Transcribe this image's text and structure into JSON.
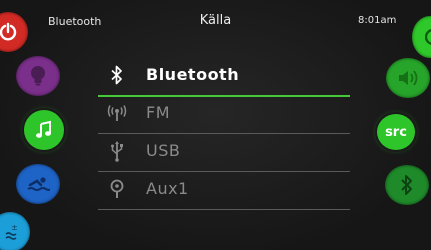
{
  "header": {
    "left_label": "Bluetooth",
    "title": "Källa",
    "time": "8:01am"
  },
  "left_buttons": [
    {
      "name": "power",
      "icon": "power-icon",
      "color": "#d22a25"
    },
    {
      "name": "light",
      "icon": "lightbulb-icon",
      "color": "#7a2f8a"
    },
    {
      "name": "audio",
      "icon": "music-note-icon",
      "color": "#2ec52a",
      "selected": true
    },
    {
      "name": "swim",
      "icon": "swimmer-icon",
      "color": "#1e63c6"
    },
    {
      "name": "temperature",
      "icon": "water-temperature-icon",
      "color": "#1c9fd9"
    }
  ],
  "right_buttons": [
    {
      "name": "top",
      "color": "#2fc82a"
    },
    {
      "name": "volume",
      "icon": "speaker-icon",
      "color": "#27a42a"
    },
    {
      "name": "source",
      "label": "src",
      "color": "#2ec52a",
      "selected": true
    },
    {
      "name": "bluetooth",
      "icon": "bluetooth-icon",
      "color": "#1f8a2a"
    }
  ],
  "source_menu": {
    "items": [
      {
        "label": "Bluetooth",
        "icon": "bluetooth-icon",
        "selected": true
      },
      {
        "label": "FM",
        "icon": "radio-antenna-icon",
        "selected": false
      },
      {
        "label": "USB",
        "icon": "usb-icon",
        "selected": false
      },
      {
        "label": "Aux1",
        "icon": "aux-input-icon",
        "selected": false
      }
    ]
  },
  "colors": {
    "accent": "#47c83a",
    "background": "#1b1b1b",
    "text_selected": "#ffffff",
    "text_dim": "#8a8a8a"
  }
}
